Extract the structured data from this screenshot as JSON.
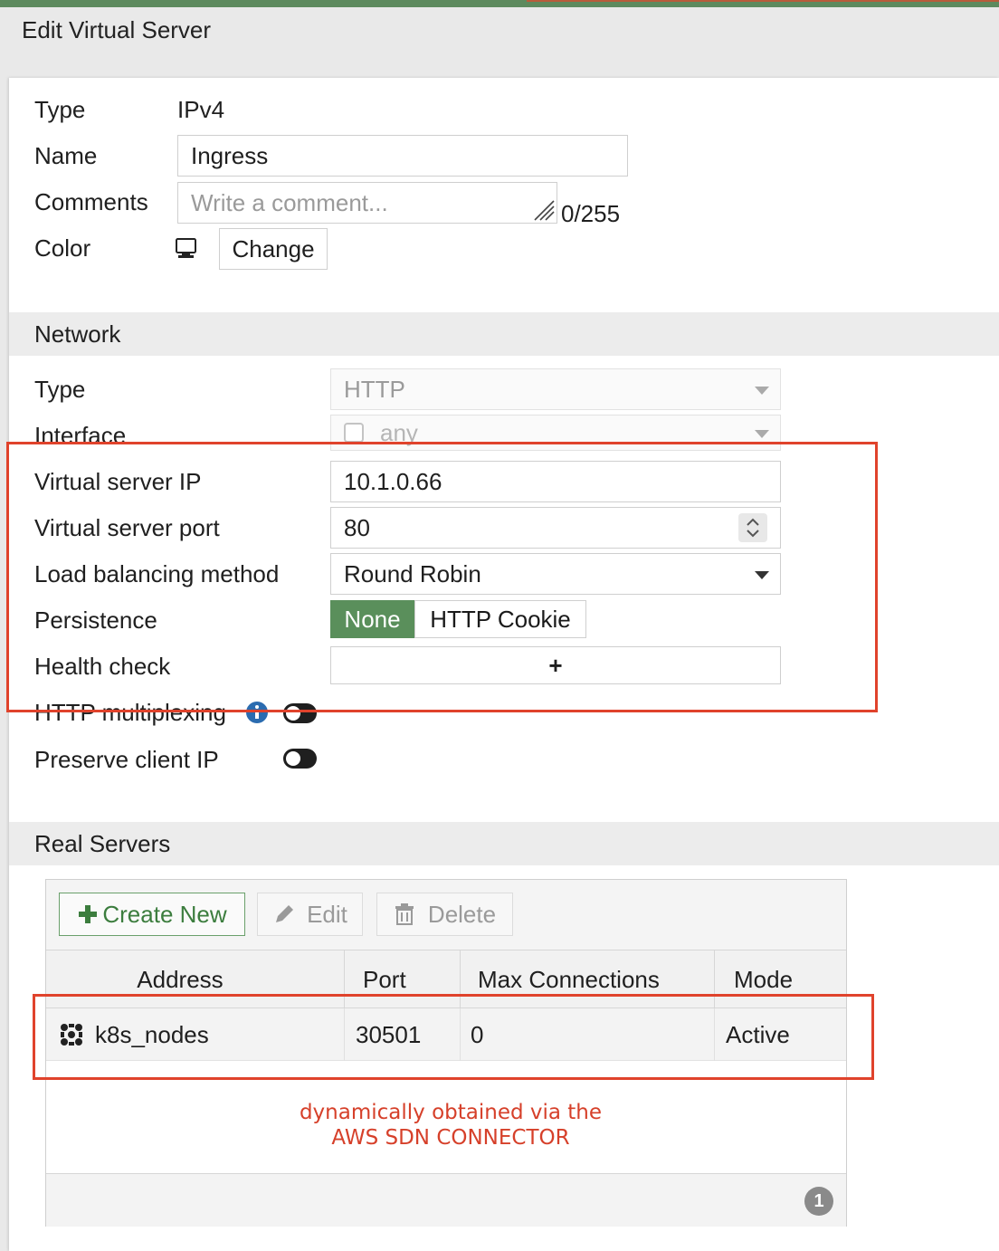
{
  "dialog": {
    "title": "Edit Virtual Server"
  },
  "general": {
    "type_label": "Type",
    "type_value": "IPv4",
    "name_label": "Name",
    "name_value": "Ingress",
    "comments_label": "Comments",
    "comments_placeholder": "Write a comment...",
    "comments_counter": "0/255",
    "color_label": "Color",
    "change_button": "Change"
  },
  "network": {
    "heading": "Network",
    "type_label": "Type",
    "type_value": "HTTP",
    "interface_label": "Interface",
    "interface_value": "any",
    "vip_label": "Virtual server IP",
    "vip_value": "10.1.0.66",
    "port_label": "Virtual server port",
    "port_value": "80",
    "lb_label": "Load balancing method",
    "lb_value": "Round Robin",
    "persistence_label": "Persistence",
    "persistence_options": [
      "None",
      "HTTP Cookie"
    ],
    "persistence_selected": "None",
    "health_label": "Health check",
    "health_add": "+",
    "multiplexing_label": "HTTP multiplexing",
    "multiplexing_enabled": false,
    "preserve_label": "Preserve client IP",
    "preserve_enabled": false
  },
  "real_servers": {
    "heading": "Real Servers",
    "toolbar": {
      "create": "Create New",
      "edit": "Edit",
      "delete": "Delete"
    },
    "columns": [
      "Address",
      "Port",
      "Max Connections",
      "Mode"
    ],
    "rows": [
      {
        "address": "k8s_nodes",
        "port": "30501",
        "max_connections": "0",
        "mode": "Active"
      }
    ],
    "count": "1"
  },
  "annotation": {
    "line1": "dynamically obtained via the",
    "line2": "AWS SDN CONNECTOR"
  },
  "colors": {
    "accent_green": "#5d8a5e",
    "annotation_red": "#e0432c",
    "info_blue": "#2b6cb0"
  }
}
